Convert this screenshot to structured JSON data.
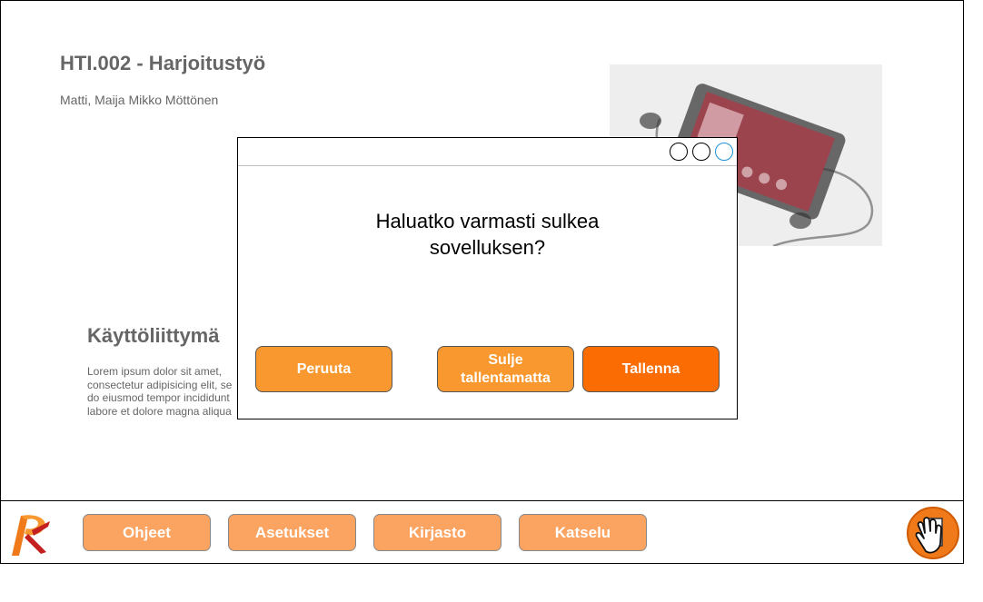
{
  "slide": {
    "title": "HTI.002 - Harjoitustyö",
    "authors": "Matti, Maija Mikko Möttönen",
    "section_heading": "Käyttöliittymä",
    "section_body": "Lorem ipsum dolor sit amet,\nconsectetur adipisicing elit, se\ndo eiusmod tempor incididunt\nlabore et dolore magna aliqua"
  },
  "dialog": {
    "message": "Haluatko varmasti sulkea\nsovelluksen?",
    "cancel_label": "Peruuta",
    "discard_label": "Sulje\ntallentamatta",
    "save_label": "Tallenna"
  },
  "toolbar": {
    "items": [
      {
        "label": "Ohjeet"
      },
      {
        "label": "Asetukset"
      },
      {
        "label": "Kirjasto"
      },
      {
        "label": "Katselu"
      }
    ]
  },
  "icons": {
    "logo": "app-logo-icon",
    "exit": "exit-hand-icon",
    "window_controls": [
      "minimize-icon",
      "maximize-icon",
      "close-icon"
    ]
  },
  "colors": {
    "dialog_button": "#f8982e",
    "primary_button": "#fb6c03",
    "toolbar_button": "#fba462",
    "heading_text": "#666666",
    "close_control": "#1e90d8"
  }
}
